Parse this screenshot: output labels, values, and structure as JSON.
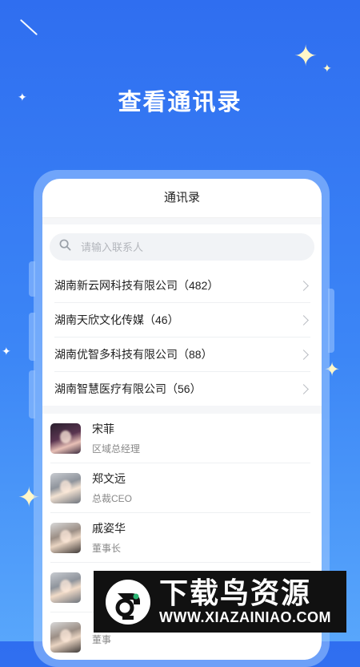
{
  "headline": "查看通讯录",
  "screen_title": "通讯录",
  "search": {
    "placeholder": "请输入联系人"
  },
  "companies": [
    {
      "label": "湖南新云网科技有限公司（482）"
    },
    {
      "label": "湖南天欣文化传媒（46）"
    },
    {
      "label": "湖南优智多科技有限公司（88）"
    },
    {
      "label": "湖南智慧医疗有限公司（56）"
    }
  ],
  "contacts": [
    {
      "name": "宋菲",
      "title": "区域总经理"
    },
    {
      "name": "郑文远",
      "title": "总裁CEO"
    },
    {
      "name": "戚姿华",
      "title": "董事长"
    },
    {
      "name": "",
      "title": ""
    },
    {
      "name": "",
      "title": "董事"
    }
  ],
  "watermark": {
    "text": "下载鸟资源",
    "url": "WWW.XIAZAINIAO.COM"
  },
  "colors": {
    "background": "#3478f3",
    "star": "#fff7c9",
    "watermark_bg": "#111111",
    "logo_accent": "#2bb673"
  }
}
